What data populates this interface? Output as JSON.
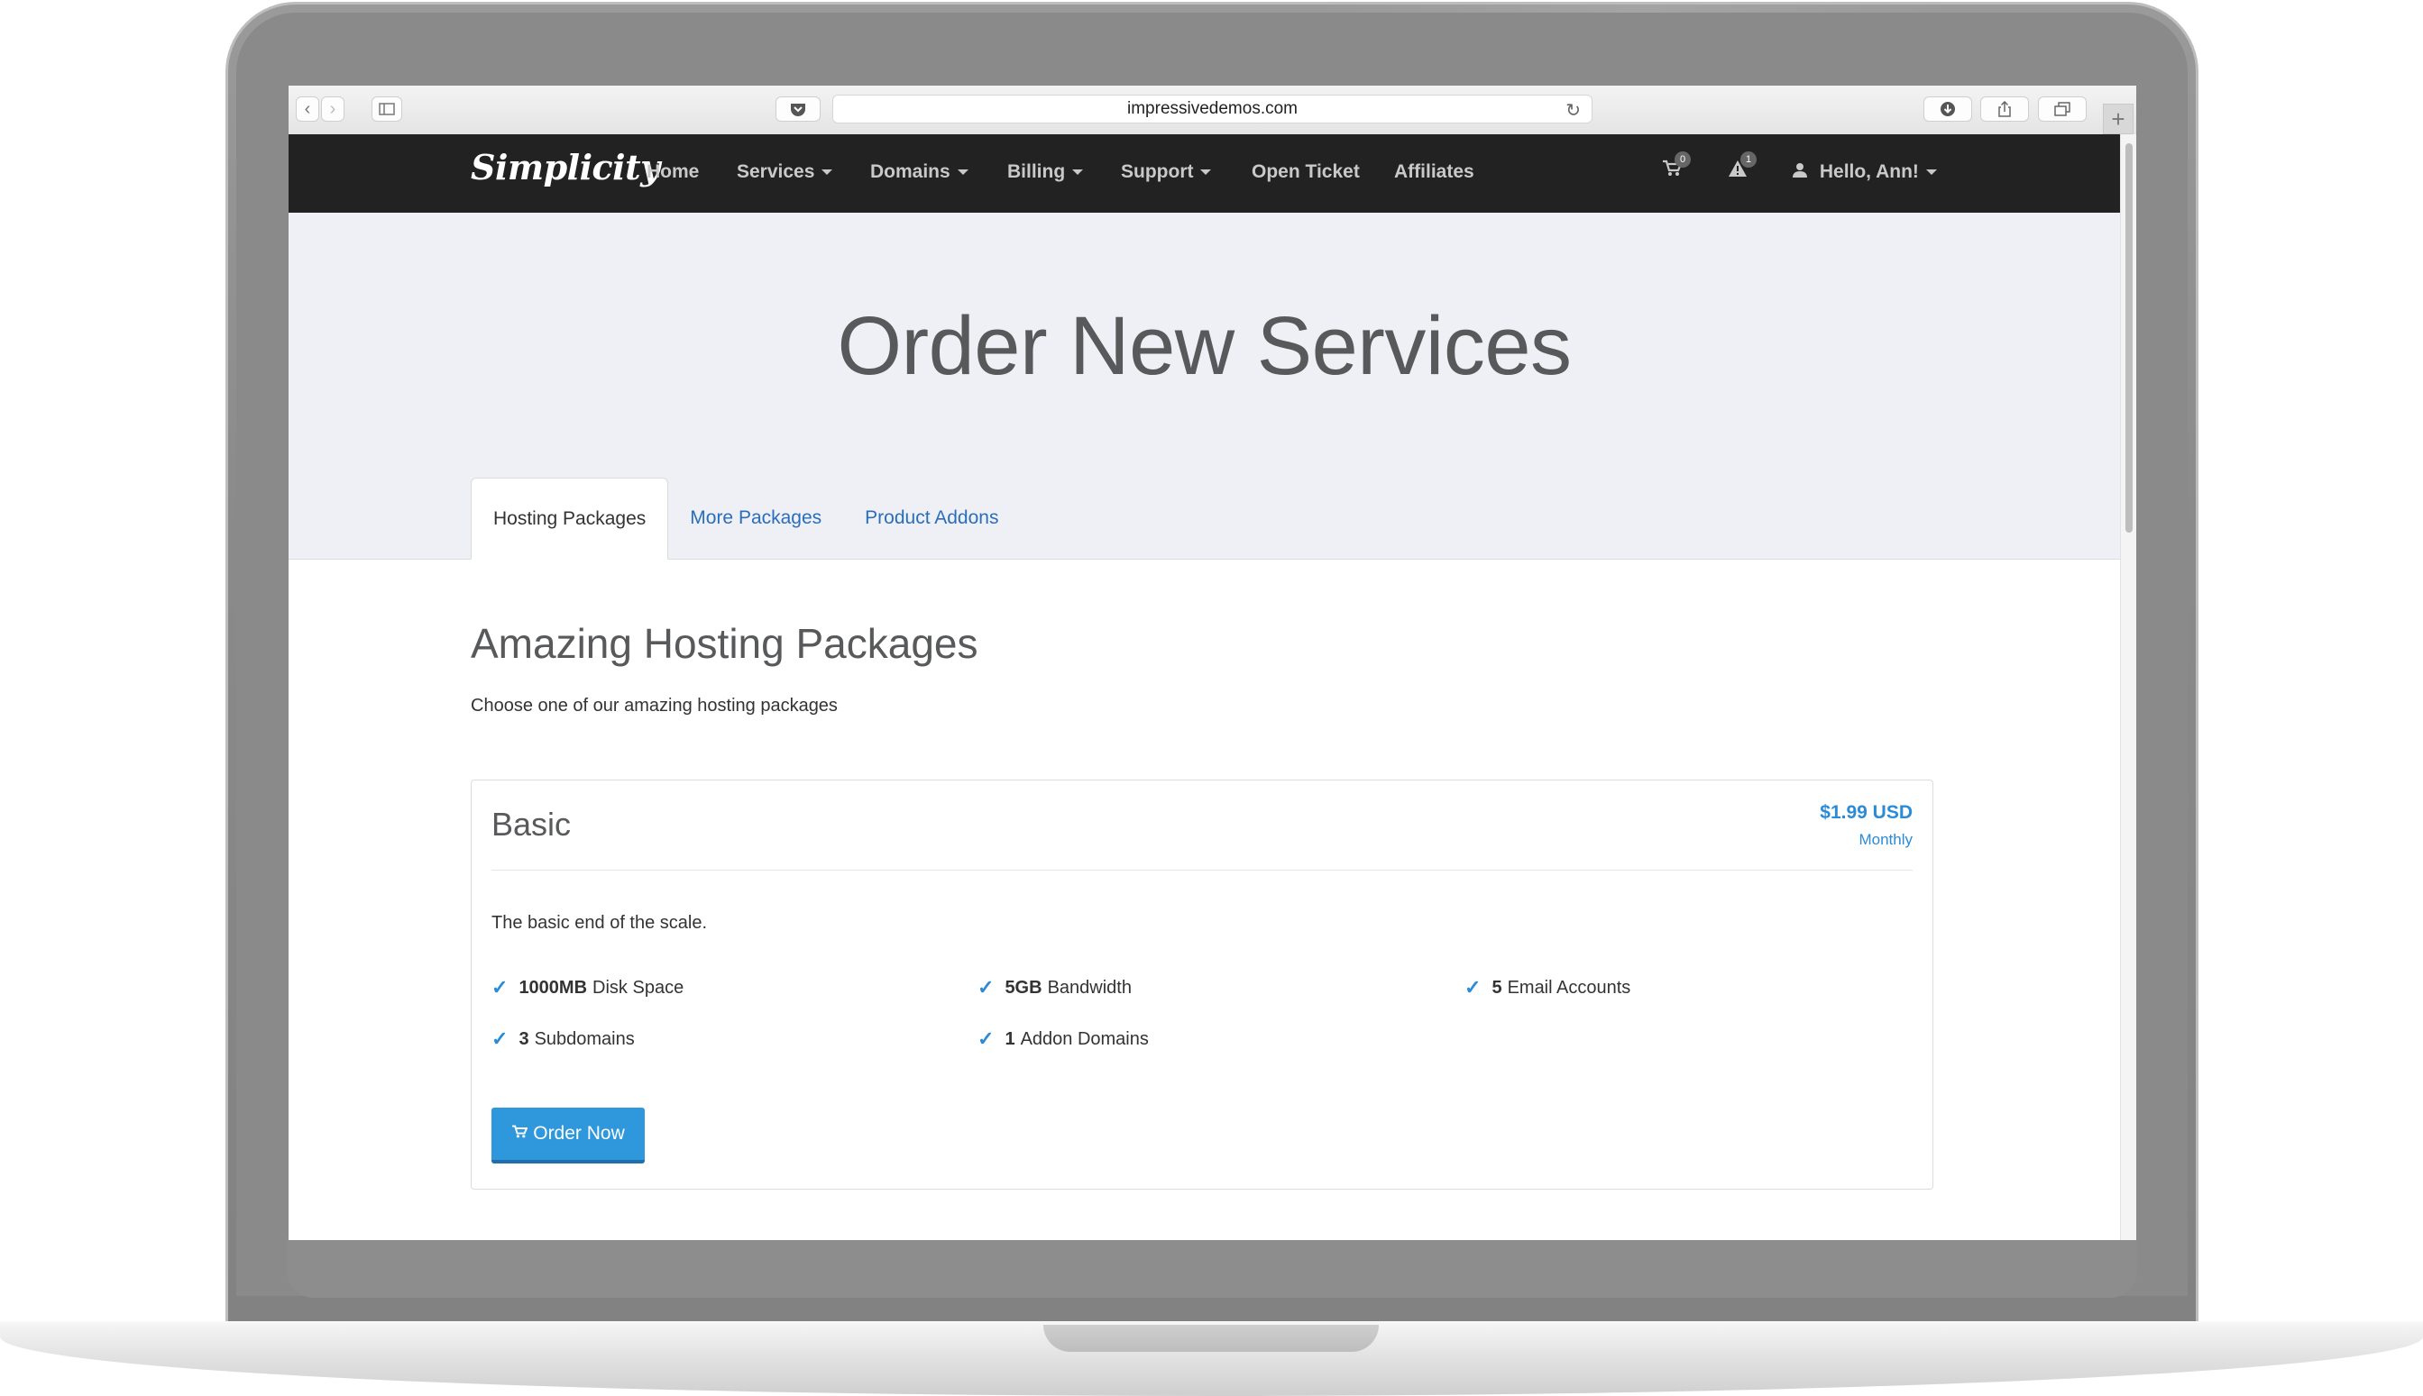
{
  "browser": {
    "url": "impressivedemos.com"
  },
  "nav": {
    "brand": "Simplicity",
    "items": [
      {
        "label": "Home",
        "dropdown": false
      },
      {
        "label": "Services",
        "dropdown": true
      },
      {
        "label": "Domains",
        "dropdown": true
      },
      {
        "label": "Billing",
        "dropdown": true
      },
      {
        "label": "Support",
        "dropdown": true
      },
      {
        "label": "Open Ticket",
        "dropdown": false
      },
      {
        "label": "Affiliates",
        "dropdown": false
      }
    ],
    "cart_count": "0",
    "notification_count": "1",
    "user_greeting": "Hello, Ann!"
  },
  "header": {
    "title": "Order New Services",
    "tabs": [
      {
        "label": "Hosting Packages",
        "active": true
      },
      {
        "label": "More Packages",
        "active": false
      },
      {
        "label": "Product Addons",
        "active": false
      }
    ]
  },
  "main": {
    "section_title": "Amazing Hosting Packages",
    "section_subtitle": "Choose one of our amazing hosting packages",
    "product": {
      "name": "Basic",
      "price": "$1.99 USD",
      "billing_cycle": "Monthly",
      "description": "The basic end of the scale.",
      "features": [
        {
          "value": "1000MB",
          "label": "Disk Space"
        },
        {
          "value": "5GB",
          "label": "Bandwidth"
        },
        {
          "value": "5",
          "label": "Email Accounts"
        },
        {
          "value": "3",
          "label": "Subdomains"
        },
        {
          "value": "1",
          "label": "Addon Domains"
        }
      ],
      "order_label": "Order Now"
    }
  },
  "colors": {
    "nav_bg": "#222222",
    "header_bg": "#eff0f5",
    "accent": "#2f97dc",
    "link": "#2a6ebb"
  }
}
